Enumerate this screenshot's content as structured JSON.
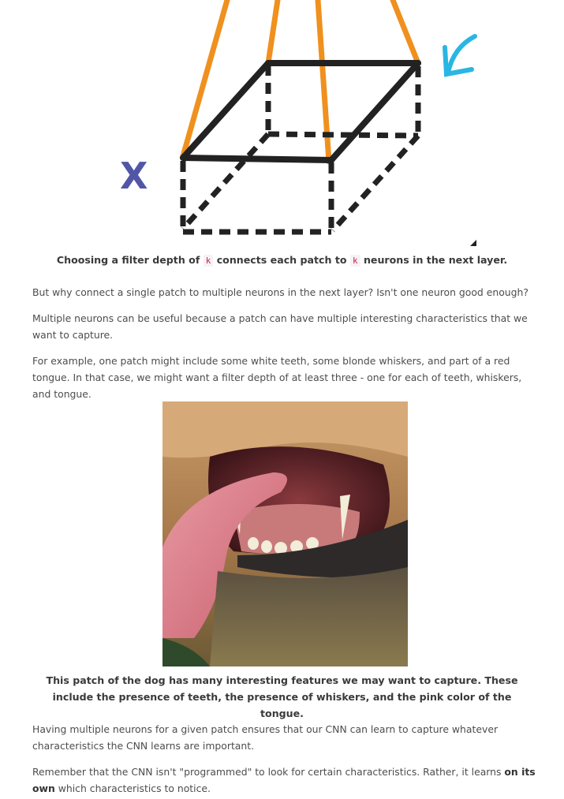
{
  "figure1": {
    "icon": "filter-depth-diagram",
    "x_label": "X",
    "caption_before": "Choosing a filter depth of ",
    "k1": "k",
    "caption_middle": " connects each patch to ",
    "k2": "k",
    "caption_after": " neurons in the next layer."
  },
  "paragraphs": {
    "p1": "But why connect a single patch to multiple neurons in the next layer? Isn't one neuron good enough?",
    "p2": "Multiple neurons can be useful because a patch can have multiple interesting characteristics that we want to capture.",
    "p3": "For example, one patch might include some white teeth, some blonde whiskers, and part of a red tongue. In that case, we might want a filter depth of at least three - one for each of teeth, whiskers, and tongue.",
    "p4": "Having multiple neurons for a given patch ensures that our CNN can learn to capture whatever characteristics the CNN learns are important.",
    "p5_before": "Remember that the CNN isn't \"programmed\" to look for certain characteristics. Rather, it learns ",
    "p5_bold": "on its own",
    "p5_after": " which characteristics to notice."
  },
  "figure2": {
    "icon": "dog-mouth-photo",
    "caption": "This patch of the dog has many interesting features we may want to capture. These include the presence of teeth, the presence of whiskers, and the pink color of the tongue."
  },
  "colors": {
    "orange_lines": "#f0901e",
    "arrow_blue": "#29b6e3",
    "x_label": "#5156a6",
    "code_text": "#c7254e"
  }
}
